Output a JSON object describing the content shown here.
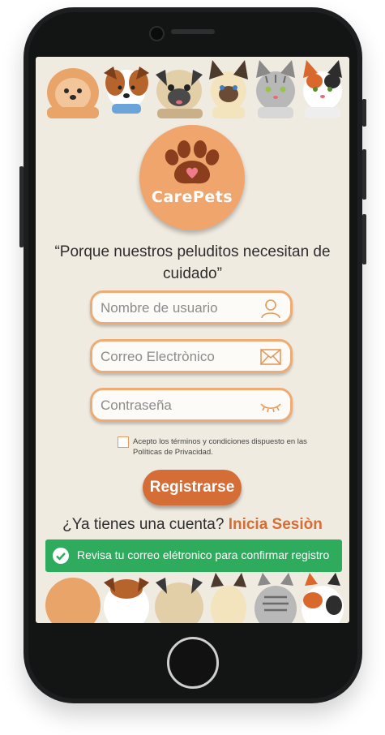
{
  "app": {
    "logo_text": "CarePets",
    "tagline": "“Porque nuestros peluditos necesitan de cuidado”"
  },
  "form": {
    "username_placeholder": "Nombre de usuario",
    "email_placeholder": "Correo Electrònico",
    "password_placeholder": "Contraseña",
    "terms_text": "Acepto los términos y condiciones dispuesto en las Políticas de Privacidad.",
    "terms_checked": false,
    "register_label": "Registrarse"
  },
  "login": {
    "prompt": "¿Ya tienes una cuenta?",
    "link_label": "Inicia Sesiòn"
  },
  "toast": {
    "message": "Revisa tu correo elétronico para confirmar registro",
    "color": "#2eab5c"
  },
  "colors": {
    "accent": "#d46e36",
    "field_border": "#eeab73",
    "logo_bg": "#f0a56d",
    "screen_bg": "#f0ebe1"
  },
  "icons": [
    "user-icon",
    "mail-icon",
    "closed-eye-icon",
    "paw-icon",
    "check-circle-icon"
  ]
}
